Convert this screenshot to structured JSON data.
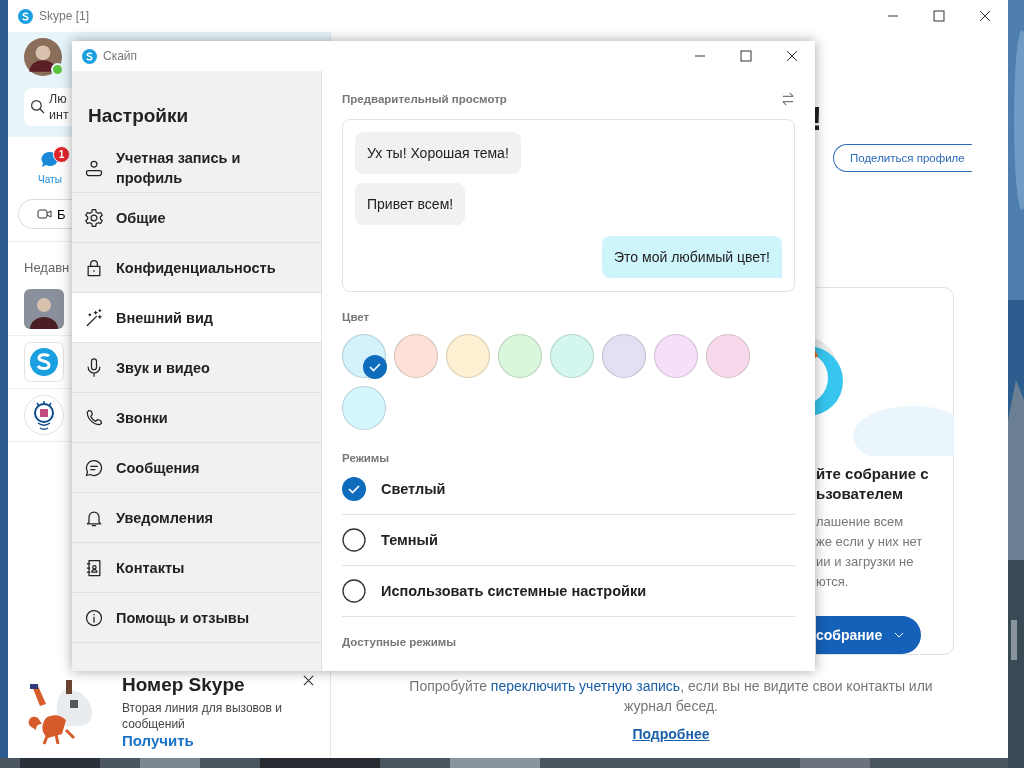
{
  "main_window": {
    "title": "Skype [1]",
    "profile": {
      "online": true
    },
    "search": {
      "lines": [
        "Лю",
        "инт"
      ]
    },
    "chats_tab": {
      "label": "Чаты",
      "badge": "1",
      "selected": true
    },
    "meet_button": {
      "label": "Б"
    },
    "recent_heading": "Недавн",
    "recent": [
      {
        "kind": "person"
      },
      {
        "kind": "skype"
      },
      {
        "kind": "bot"
      }
    ],
    "promo": {
      "title": "Номер Skype",
      "text": "Вторая линия для вызовов и сообщений",
      "link": "Получить"
    },
    "heading_end": "!",
    "share_button": "Поделиться профиле",
    "card": {
      "heading": [
        "йте собрание с",
        "ьзователем"
      ],
      "body": [
        "лашение всем",
        "же если у них нет",
        "ии и загрузки не",
        "ются."
      ],
      "button": "собрание"
    },
    "footer": {
      "before": "Попробуйте ",
      "link": "переключить учетную запись",
      "after": ", если вы не видите свои контакты или журнал бесед.",
      "more": "Подробнее"
    }
  },
  "settings": {
    "title": "Скайп",
    "heading": "Настройки",
    "nav": [
      {
        "label": "Учетная запись и профиль",
        "selected": false
      },
      {
        "label": "Общие",
        "selected": false
      },
      {
        "label": "Конфиденциальность",
        "selected": false
      },
      {
        "label": "Внешний вид",
        "selected": true
      },
      {
        "label": "Звук и видео",
        "selected": false
      },
      {
        "label": "Звонки",
        "selected": false
      },
      {
        "label": "Сообщения",
        "selected": false
      },
      {
        "label": "Уведомления",
        "selected": false
      },
      {
        "label": "Контакты",
        "selected": false
      },
      {
        "label": "Помощь и отзывы",
        "selected": false
      }
    ],
    "preview_label": "Предварительный просмотр",
    "messages": [
      {
        "text": "Ух ты! Хорошая тема!",
        "mine": false
      },
      {
        "text": "Привет всем!",
        "mine": false
      },
      {
        "text": "Это мой любимый цвет!",
        "mine": true
      }
    ],
    "color_label": "Цвет",
    "colors": [
      {
        "color": "#d3f2fc",
        "selected": true
      },
      {
        "color": "#fde0d6",
        "selected": false
      },
      {
        "color": "#fdf0d2",
        "selected": false
      },
      {
        "color": "#d8f7dc",
        "selected": false
      },
      {
        "color": "#d3f7ef",
        "selected": false
      },
      {
        "color": "#e3e0f4",
        "selected": false
      },
      {
        "color": "#f6e0f9",
        "selected": false
      },
      {
        "color": "#f8d9ec",
        "selected": false
      },
      {
        "color": "#d6f6fd",
        "selected": false
      }
    ],
    "modes_label": "Режимы",
    "modes": [
      {
        "label": "Светлый",
        "selected": true
      },
      {
        "label": "Темный",
        "selected": false
      },
      {
        "label": "Использовать системные настройки",
        "selected": false
      }
    ],
    "available_label": "Доступные режимы"
  }
}
